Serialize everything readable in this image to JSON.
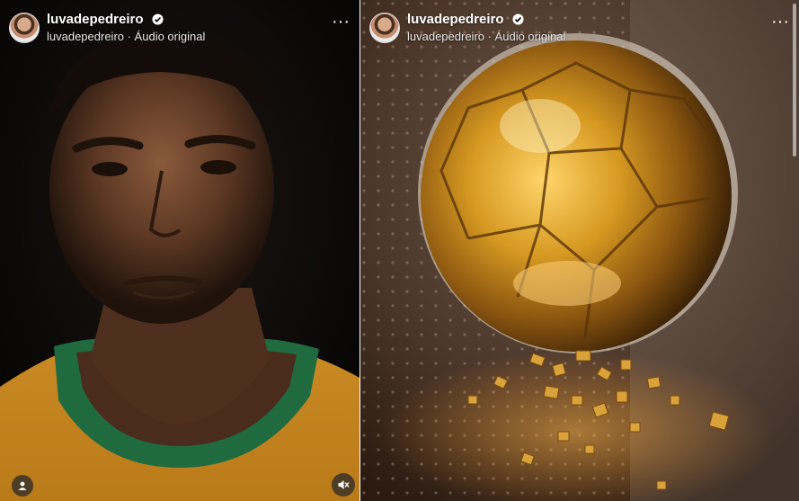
{
  "left_post": {
    "username": "luvadepedreiro",
    "subtitle": "luvadepedreiro · Áudio original",
    "icons": [
      "verified-badge-icon",
      "more-options-icon",
      "person-tag-icon"
    ],
    "image_description_name": "portrait-image"
  },
  "right_post": {
    "username": "luvadepedreiro",
    "subtitle": "luvadepedreiro · Áudio original",
    "icons": [
      "verified-badge-icon",
      "more-options-icon",
      "mute-icon"
    ],
    "image_description_name": "golden-ball-image"
  },
  "colors": {
    "shirt": "#d49a2a",
    "collar": "#1f6b3f",
    "gold": "#e0a52a",
    "verified": "#3897f0"
  }
}
